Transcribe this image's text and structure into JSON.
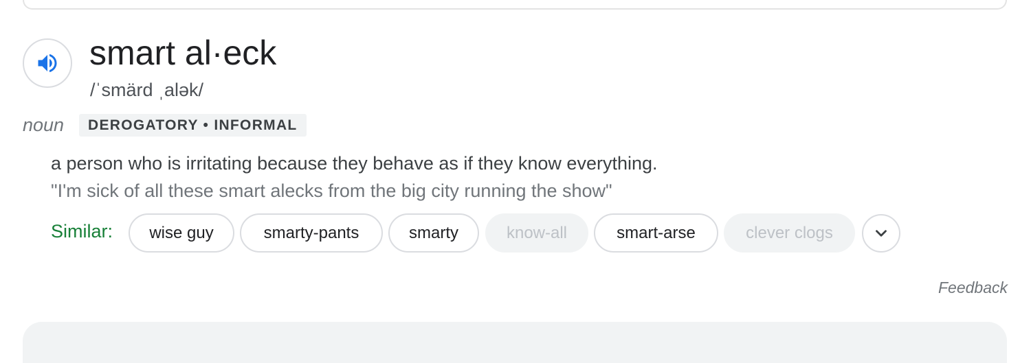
{
  "entry": {
    "headword": "smart al·eck",
    "pronunciation": "/ˈsmärd ˌalək/",
    "part_of_speech": "noun",
    "usage_label": "DEROGATORY • INFORMAL",
    "definition": "a person who is irritating because they behave as if they know everything.",
    "example": "\"I'm sick of all these smart alecks from the big city running the show\""
  },
  "similar": {
    "label": "Similar:",
    "chips": [
      {
        "text": "wise guy",
        "enabled": true
      },
      {
        "text": "smarty-pants",
        "enabled": true
      },
      {
        "text": "smarty",
        "enabled": true
      },
      {
        "text": "know-all",
        "enabled": false
      },
      {
        "text": "smart-arse",
        "enabled": true
      },
      {
        "text": "clever clogs",
        "enabled": false
      }
    ]
  },
  "feedback_label": "Feedback",
  "icons": {
    "audio": "speaker-icon",
    "expand": "chevron-down-icon"
  },
  "colors": {
    "accent_blue": "#1a73e8",
    "similar_green": "#188038"
  }
}
